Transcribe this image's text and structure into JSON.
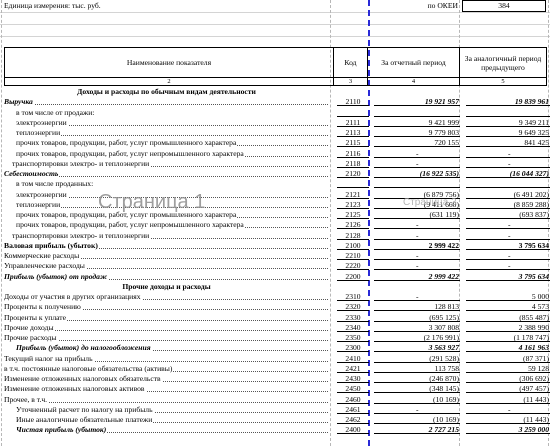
{
  "unit": {
    "label": "Единица измерения: тыс. руб.",
    "okei_label": "по ОКЕИ",
    "okei_value": "384"
  },
  "header": {
    "name": "Наименование показателя",
    "code": "Код",
    "current": "За отчетный период",
    "previous": "За аналогичный период предыдущего",
    "nums": [
      "2",
      "3",
      "4",
      "5"
    ]
  },
  "watermarks": {
    "page1": "Страница 1",
    "page3": "Страница 3"
  },
  "rows": [
    {
      "type": "section",
      "name": "Доходы и расходы по обычным видам деятельности"
    },
    {
      "name": "Выручка",
      "style": "bi",
      "code": "2110",
      "v1": "19 921 957",
      "v2": "19 839 961",
      "vstyle": "bi"
    },
    {
      "name": "в том числе от продажи:",
      "indent": "i2",
      "code": "",
      "v1": "",
      "v2": "",
      "noline": true
    },
    {
      "name": "электроэнергии",
      "indent": "i2",
      "code": "2111",
      "v1": "9 421 999",
      "v2": "9 349 211"
    },
    {
      "name": "теплоэнергии",
      "indent": "i2",
      "code": "2113",
      "v1": "9 779 803",
      "v2": "9 649 325"
    },
    {
      "name": "прочих товаров, продукции, работ, услуг промышленного характера",
      "indent": "i2",
      "code": "2115",
      "v1": "720 155",
      "v2": "841 425"
    },
    {
      "name": "прочих товаров, продукции, работ, услуг непромышленного характера",
      "indent": "i2",
      "code": "2116",
      "v1": "-",
      "v2": "-"
    },
    {
      "name": "транспортировки электро- и теплоэнергии",
      "indent": "i1",
      "code": "2118",
      "v1": "-",
      "v2": "-"
    },
    {
      "name": "Себестоимость",
      "style": "bi",
      "code": "2120",
      "v1": "(16 922 535)",
      "v2": "(16 044 327)",
      "vstyle": "bi"
    },
    {
      "name": "в том числе проданных:",
      "indent": "i2",
      "code": "",
      "v1": "",
      "v2": "",
      "noline": true
    },
    {
      "name": "электроэнергии",
      "indent": "i2",
      "code": "2121",
      "v1": "(6 879 756)",
      "v2": "(6 491 202)"
    },
    {
      "name": "теплоэнергии",
      "indent": "i2",
      "code": "2123",
      "v1": "(9 411 660)",
      "v2": "(8 859 288)"
    },
    {
      "name": "прочих товаров, продукции, работ, услуг промышленного характера",
      "indent": "i2",
      "code": "2125",
      "v1": "(631 119)",
      "v2": "(693 837)"
    },
    {
      "name": "прочих товаров, продукции, работ, услуг непромышленного характера",
      "indent": "i2",
      "code": "2126",
      "v1": "-",
      "v2": "-"
    },
    {
      "name": "транспортировки электро- и теплоэнергии",
      "indent": "i1",
      "code": "2128",
      "v1": "-",
      "v2": "-"
    },
    {
      "name": "Валовая прибыль (убыток)",
      "style": "b",
      "code": "2100",
      "v1": "2 999 422",
      "v2": "3 795 634",
      "vstyle": "b"
    },
    {
      "name": "Коммерческие расходы",
      "code": "2210",
      "v1": "-",
      "v2": "-"
    },
    {
      "name": "Управленческие расходы",
      "code": "2220",
      "v1": "-",
      "v2": "-"
    },
    {
      "name": "Прибыль (убыток) от продаж",
      "style": "bi",
      "code": "2200",
      "v1": "2 999 422",
      "v2": "3 795 634",
      "vstyle": "bi"
    },
    {
      "type": "section",
      "name": "Прочие доходы и расходы"
    },
    {
      "name": "Доходы от участия в других организациях",
      "code": "2310",
      "v1": "-",
      "v2": "5 000"
    },
    {
      "name": "Проценты к получению",
      "code": "2320",
      "v1": "128 813",
      "v2": "4 573"
    },
    {
      "name": "Проценты к уплате",
      "code": "2330",
      "v1": "(695 125)",
      "v2": "(855 487)"
    },
    {
      "name": "Прочие доходы",
      "code": "2340",
      "v1": "3 307 808",
      "v2": "2 388 990"
    },
    {
      "name": "Прочие расходы",
      "code": "2350",
      "v1": "(2 176 991)",
      "v2": "(1 178 747)"
    },
    {
      "name": "Прибыль (убыток) до налогообложения",
      "style": "bi",
      "indent": "i2",
      "code": "2300",
      "v1": "3 563 927",
      "v2": "4 161 963",
      "vstyle": "bi"
    },
    {
      "name": "Текущий налог на прибыль",
      "code": "2410",
      "v1": "(291 528)",
      "v2": "(87 371)"
    },
    {
      "name": "в т.ч. постоянные налоговые обязательства (активы)",
      "code": "2421",
      "v1": "113 758",
      "v2": "59 128"
    },
    {
      "name": "Изменение отложенных налоговых обязательств",
      "code": "2430",
      "v1": "(246 870)",
      "v2": "(306 692)"
    },
    {
      "name": "Изменение отложенных налоговых активов",
      "code": "2450",
      "v1": "(348 145)",
      "v2": "(497 457)"
    },
    {
      "name": "Прочее, в т.ч.",
      "code": "2460",
      "v1": "(10 169)",
      "v2": "(11 443)"
    },
    {
      "name": "Уточненный расчет по налогу на прибыль",
      "indent": "i2",
      "code": "2461",
      "v1": "-",
      "v2": "-"
    },
    {
      "name": "Иные аналогичные обязательные платежи",
      "indent": "i2",
      "code": "2462",
      "v1": "(10 169)",
      "v2": "(11 443)"
    },
    {
      "name": "Чистая прибыль (убыток)",
      "style": "bi",
      "indent": "i2",
      "code": "2400",
      "v1": "2 727 215",
      "v2": "3 259 000",
      "vstyle": "bi"
    }
  ]
}
